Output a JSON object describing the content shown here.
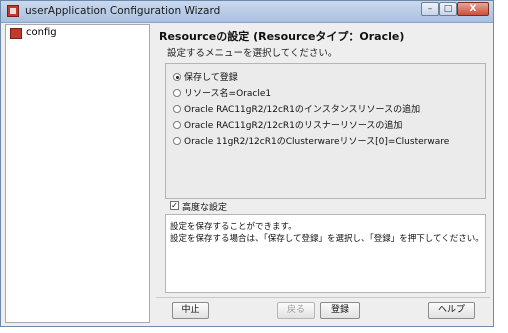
{
  "window": {
    "title": "userApplication Configuration Wizard",
    "controls": {
      "minimize": "–",
      "maximize": "□",
      "close": "X"
    }
  },
  "tree": {
    "items": [
      {
        "label": "config",
        "icon": "config-icon"
      }
    ]
  },
  "main": {
    "header": "Resourceの設定 (Resourceタイプ：Oracle)",
    "subheader": "設定するメニューを選択してください。",
    "options": [
      {
        "label": "保存して登録",
        "selected": true
      },
      {
        "label": "リソース名=Oracle1",
        "selected": false
      },
      {
        "label": "Oracle RAC11gR2/12cR1のインスタンスリソースの追加",
        "selected": false
      },
      {
        "label": "Oracle RAC11gR2/12cR1のリスナーリソースの追加",
        "selected": false
      },
      {
        "label": "Oracle 11gR2/12cR1のClusterwareリソース[0]=Clusterware",
        "selected": false
      }
    ],
    "advanced": {
      "label": "高度な設定",
      "checked": true
    },
    "description": [
      "設定を保存することができます。",
      "設定を保存する場合は、「保存して登録」を選択し、「登録」を押下してください。"
    ]
  },
  "buttons": {
    "cancel": "中止",
    "back": "戻る",
    "register": "登録",
    "help": "ヘルプ"
  }
}
